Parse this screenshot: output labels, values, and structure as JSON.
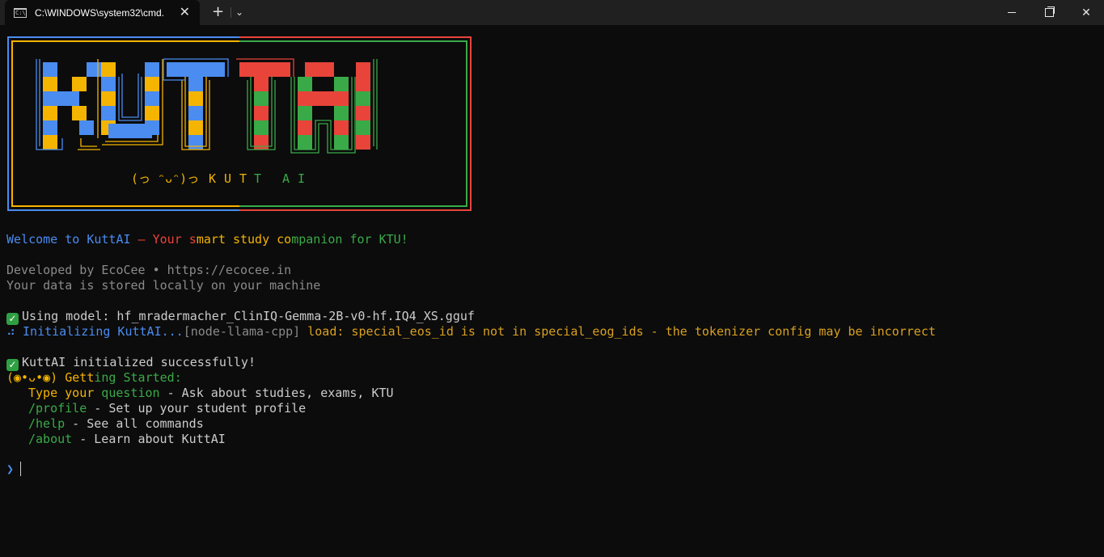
{
  "window": {
    "tab_title": "C:\\WINDOWS\\system32\\cmd.",
    "icon_text": "C:\\",
    "new_tab_symbol": "+",
    "dropdown_symbol": "⌄",
    "close_tab_symbol": "✕",
    "close_window_symbol": "✕"
  },
  "banner": {
    "logo_text": "KUTTAI",
    "tagline_face": "(っ ᵔᴗᵔ)っ",
    "tagline_letters": [
      "K",
      "U",
      "T",
      "T",
      "A",
      "I"
    ],
    "colors": {
      "blue": "#4a8cf0",
      "yellow": "#f5b400",
      "red": "#e8443a",
      "green": "#3aaa48"
    }
  },
  "welcome": {
    "segments": [
      {
        "text": "Welcome to KuttAI",
        "color": "blue"
      },
      {
        "text": " – Your s",
        "color": "red"
      },
      {
        "text": "mart study co",
        "color": "yellow"
      },
      {
        "text": "mpanion for KTU!",
        "color": "green"
      }
    ]
  },
  "info": {
    "developer": "Developed by EcoCee • https://ecocee.in",
    "storage": "Your data is stored locally on your machine"
  },
  "status": {
    "check_symbol": "✓",
    "model_line": "Using model: hf_mradermacher_ClinIQ-Gemma-2B-v0-hf.IQ4_XS.gguf",
    "init_prefix": "⠴ Initializing KuttAI...",
    "init_tag": "[node-llama-cpp]",
    "init_warning": " load: special_eos_id is not in special_eog_ids - the tokenizer config may be incorrect",
    "success_line": "KuttAI initialized successfully!"
  },
  "getting_started": {
    "face": "(◉•ᴗ•◉)",
    "title_a": " Gett",
    "title_b": "ing Started:",
    "items": [
      {
        "cmd_a": "Type your",
        "cmd_b": " question",
        "desc": " - Ask about studies, exams, KTU"
      },
      {
        "cmd_a": "/profile",
        "cmd_b": "",
        "desc": " - Set up your student profile"
      },
      {
        "cmd_a": "/help",
        "cmd_b": "",
        "desc": " - See all commands"
      },
      {
        "cmd_a": "/about",
        "cmd_b": "",
        "desc": " - Learn about KuttAI"
      }
    ]
  },
  "prompt": {
    "symbol": "❯",
    "value": ""
  }
}
